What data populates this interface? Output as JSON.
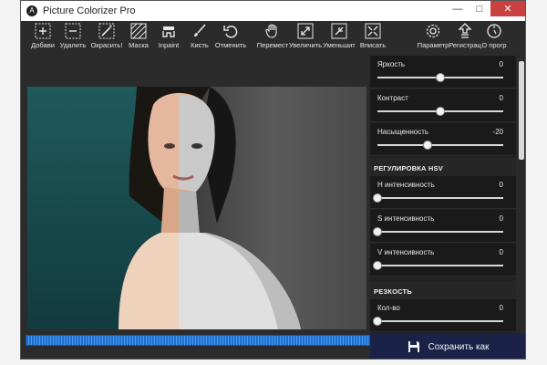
{
  "window": {
    "title": "Picture Colorizer Pro",
    "icon": "app-logo-icon"
  },
  "toolbar": {
    "tools": [
      {
        "label": "Добави",
        "icon": "add-icon"
      },
      {
        "label": "Удалить",
        "icon": "remove-icon"
      },
      {
        "label": "Окрасить!",
        "icon": "colorize-wand-icon"
      },
      {
        "label": "Маска",
        "icon": "mask-icon"
      },
      {
        "label": "Inpaint",
        "icon": "inpaint-icon"
      },
      {
        "label": "Кисть",
        "icon": "brush-icon"
      },
      {
        "label": "Отменить",
        "icon": "undo-icon"
      },
      {
        "label": "Перемест",
        "icon": "hand-icon"
      },
      {
        "label": "Увеличить",
        "icon": "zoom-in-icon"
      },
      {
        "label": "Уменьшит",
        "icon": "zoom-out-icon"
      },
      {
        "label": "Вписать",
        "icon": "fit-icon"
      },
      {
        "label": "Параметр",
        "icon": "gear-icon"
      },
      {
        "label": "Регистрац",
        "icon": "register-icon"
      },
      {
        "label": "О прогр",
        "icon": "about-icon"
      }
    ]
  },
  "progress": {
    "text": "",
    "percent": 100
  },
  "panel": {
    "sliders_top": [
      {
        "label": "Яркость",
        "value": "0",
        "fraction": 0.5
      },
      {
        "label": "Контраст",
        "value": "0",
        "fraction": 0.5
      },
      {
        "label": "Насыщенность",
        "value": "-20",
        "fraction": 0.4
      }
    ],
    "hsv_section": "РЕГУЛИРОВКА HSV",
    "sliders_hsv": [
      {
        "label": "H интенсивность",
        "value": "0",
        "fraction": 0.0
      },
      {
        "label": "S интенсивность",
        "value": "0",
        "fraction": 0.0
      },
      {
        "label": "V интенсивность",
        "value": "0",
        "fraction": 0.0
      }
    ],
    "sharp_section": "РЕЗКОСТЬ",
    "sliders_sharp": [
      {
        "label": "Кол-во",
        "value": "0",
        "fraction": 0.0
      }
    ]
  },
  "save": {
    "label": "Сохранить как",
    "icon": "floppy-disk-icon"
  }
}
